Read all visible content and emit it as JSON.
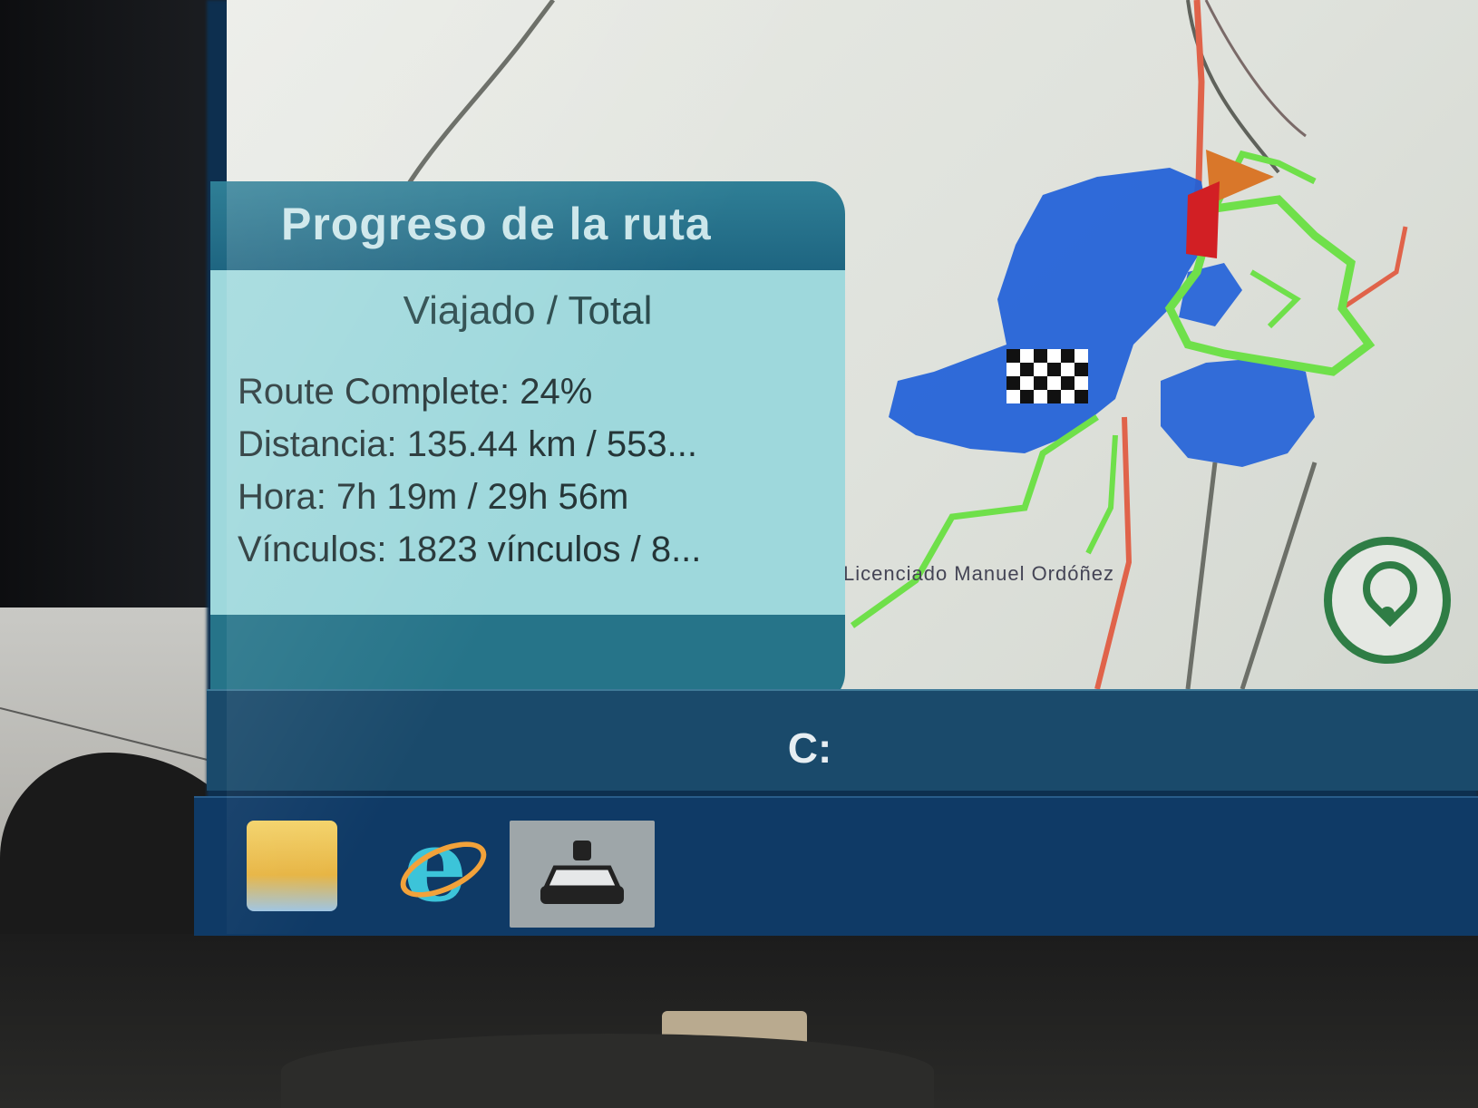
{
  "route_progress_panel": {
    "title": "Progreso de la ruta",
    "subtitle": "Viajado / Total",
    "route_complete": "Route Complete: 24%",
    "distance": "Distancia: 135.44 km / 553...",
    "time": "Hora: 7h 19m / 29h 56m",
    "links": "Vínculos: 1823 vínculos / 8..."
  },
  "map": {
    "street_label": "Licenciado Manuel Ordóñez",
    "colors": {
      "traveled_route": "#1f5fd8",
      "remaining_route": "#6fe04a",
      "main_road": "#e0634a",
      "minor_road": "#5f625b",
      "background": "#e5e8e2"
    }
  },
  "buttons": {
    "locate": "location-pin-icon"
  },
  "status_bar": {
    "storage_icon": "C:"
  },
  "taskbar": {
    "items": [
      {
        "name": "file-explorer-icon"
      },
      {
        "name": "internet-explorer-icon"
      },
      {
        "name": "navigation-app-icon"
      }
    ]
  }
}
